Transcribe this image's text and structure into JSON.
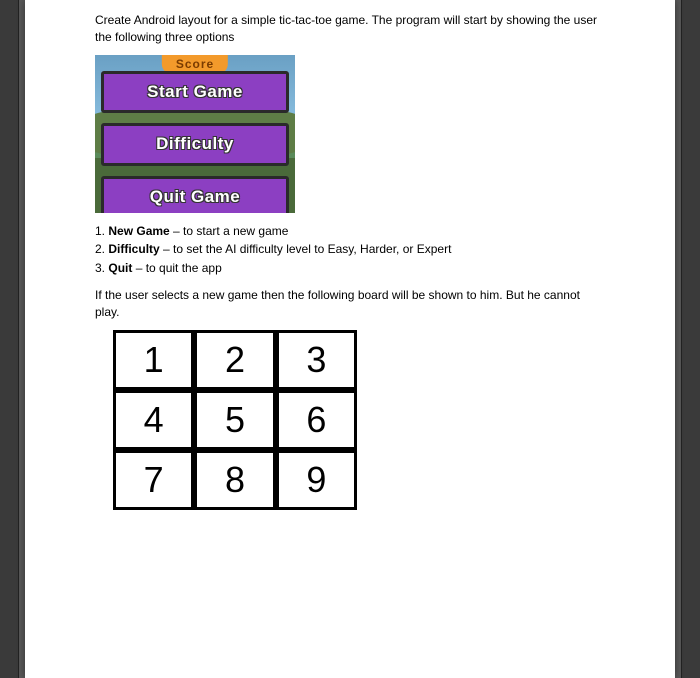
{
  "intro": "Create Android layout for a simple tic-tac-toe game. The program will start by showing the user the following three options",
  "menu": {
    "banner": "Score",
    "buttons": [
      "Start Game",
      "Difficulty",
      "Quit Game"
    ]
  },
  "list": [
    {
      "num": "1.",
      "term": "New Game",
      "rest": " – to start a new game"
    },
    {
      "num": "2.",
      "term": "Difficulty",
      "rest": " – to set the AI difficulty level to Easy, Harder, or Expert"
    },
    {
      "num": "3.",
      "term": "Quit",
      "rest": " – to quit the app"
    }
  ],
  "after_list": "If the user selects a new game then the following board will be shown to him. But he cannot play.",
  "board": [
    "1",
    "2",
    "3",
    "4",
    "5",
    "6",
    "7",
    "8",
    "9"
  ]
}
